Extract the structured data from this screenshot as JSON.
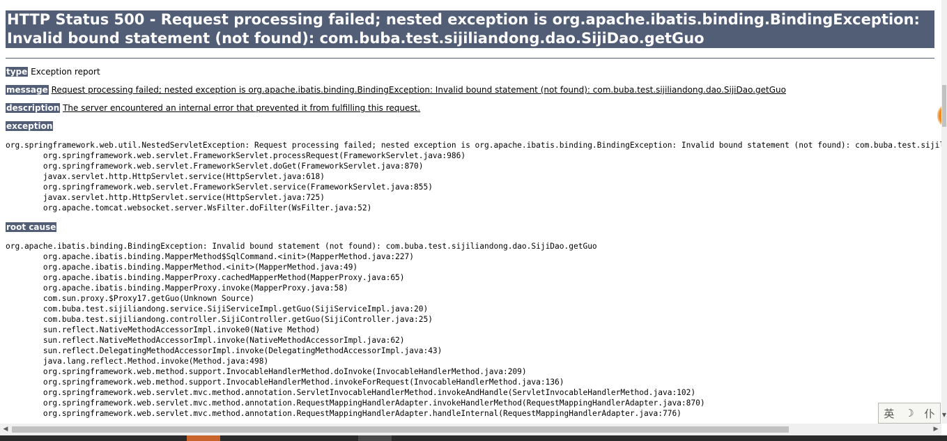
{
  "title": "HTTP Status 500 - Request processing failed; nested exception is org.apache.ibatis.binding.BindingException: Invalid bound statement (not found): com.buba.test.sijiliandong.dao.SijiDao.getGuo",
  "type": {
    "label": "type",
    "value": "Exception report"
  },
  "message": {
    "label": "message",
    "value": "Request processing failed; nested exception is org.apache.ibatis.binding.BindingException: Invalid bound statement (not found): com.buba.test.sijiliandong.dao.SijiDao.getGuo"
  },
  "description": {
    "label": "description",
    "value": "The server encountered an internal error that prevented it from fulfilling this request."
  },
  "exception": {
    "label": "exception",
    "trace": "org.springframework.web.util.NestedServletException: Request processing failed; nested exception is org.apache.ibatis.binding.BindingException: Invalid bound statement (not found): com.buba.test.sijiliandong.dao.SijiDao.getGuo\n\torg.springframework.web.servlet.FrameworkServlet.processRequest(FrameworkServlet.java:986)\n\torg.springframework.web.servlet.FrameworkServlet.doGet(FrameworkServlet.java:870)\n\tjavax.servlet.http.HttpServlet.service(HttpServlet.java:618)\n\torg.springframework.web.servlet.FrameworkServlet.service(FrameworkServlet.java:855)\n\tjavax.servlet.http.HttpServlet.service(HttpServlet.java:725)\n\torg.apache.tomcat.websocket.server.WsFilter.doFilter(WsFilter.java:52)"
  },
  "root_cause": {
    "label": "root cause",
    "trace": "org.apache.ibatis.binding.BindingException: Invalid bound statement (not found): com.buba.test.sijiliandong.dao.SijiDao.getGuo\n\torg.apache.ibatis.binding.MapperMethod$SqlCommand.<init>(MapperMethod.java:227)\n\torg.apache.ibatis.binding.MapperMethod.<init>(MapperMethod.java:49)\n\torg.apache.ibatis.binding.MapperProxy.cachedMapperMethod(MapperProxy.java:65)\n\torg.apache.ibatis.binding.MapperProxy.invoke(MapperProxy.java:58)\n\tcom.sun.proxy.$Proxy17.getGuo(Unknown Source)\n\tcom.buba.test.sijiliandong.service.SijiServiceImpl.getGuo(SijiServiceImpl.java:20)\n\tcom.buba.test.sijiliandong.controller.SijiController.getGuo(SijiController.java:25)\n\tsun.reflect.NativeMethodAccessorImpl.invoke0(Native Method)\n\tsun.reflect.NativeMethodAccessorImpl.invoke(NativeMethodAccessorImpl.java:62)\n\tsun.reflect.DelegatingMethodAccessorImpl.invoke(DelegatingMethodAccessorImpl.java:43)\n\tjava.lang.reflect.Method.invoke(Method.java:498)\n\torg.springframework.web.method.support.InvocableHandlerMethod.doInvoke(InvocableHandlerMethod.java:209)\n\torg.springframework.web.method.support.InvocableHandlerMethod.invokeForRequest(InvocableHandlerMethod.java:136)\n\torg.springframework.web.servlet.mvc.method.annotation.ServletInvocableHandlerMethod.invokeAndHandle(ServletInvocableHandlerMethod.java:102)\n\torg.springframework.web.servlet.mvc.method.annotation.RequestMappingHandlerAdapter.invokeHandlerMethod(RequestMappingHandlerAdapter.java:870)\n\torg.springframework.web.servlet.mvc.method.annotation.RequestMappingHandlerAdapter.handleInternal(RequestMappingHandlerAdapter.java:776)"
  },
  "ime": {
    "lang": "英",
    "punct": "ﾉ",
    "mode": "仆"
  },
  "colors": {
    "header_bg": "#525D76",
    "header_text": "#FFFFFF",
    "badge": "#F08A24"
  },
  "icons": [
    "scroll-left-arrow-icon",
    "scroll-right-arrow-icon",
    "scroll-down-arrow-icon",
    "moon-icon"
  ]
}
